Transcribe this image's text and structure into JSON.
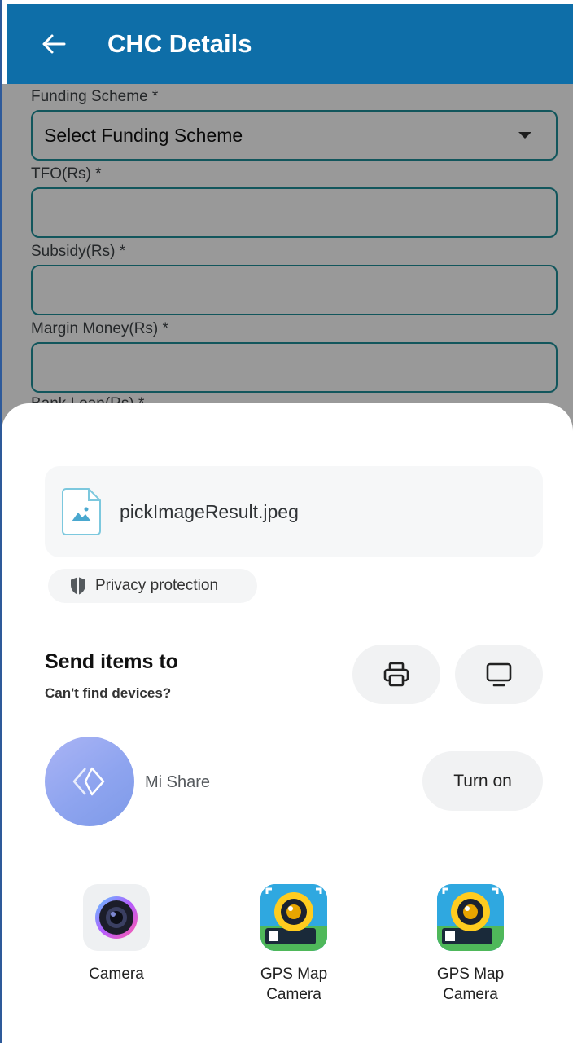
{
  "appbar": {
    "title": "CHC Details"
  },
  "form": {
    "fields": [
      {
        "label": "Funding Scheme *",
        "value": "Select Funding Scheme"
      },
      {
        "label": "TFO(Rs) *",
        "value": ""
      },
      {
        "label": "Subsidy(Rs) *",
        "value": ""
      },
      {
        "label": "Margin Money(Rs) *",
        "value": ""
      },
      {
        "label": "Bank Loan(Rs) *"
      }
    ]
  },
  "share_sheet": {
    "file_name": "pickImageResult.jpeg",
    "privacy_label": "Privacy protection",
    "send_title": "Send items to",
    "send_subtitle": "Can't find devices?",
    "mishare_label": "Mi Share",
    "turn_on_label": "Turn on",
    "apps": [
      {
        "label": "Camera",
        "icon": "camera-app-icon"
      },
      {
        "label": "GPS Map Camera",
        "icon": "gps-map-camera-icon"
      },
      {
        "label": "GPS Map Camera",
        "icon": "gps-map-camera-icon"
      }
    ]
  },
  "colors": {
    "appbar": "#0e6ea8",
    "field_border": "#1f8f9a",
    "scrim": "rgba(0,0,0,0.40)"
  }
}
